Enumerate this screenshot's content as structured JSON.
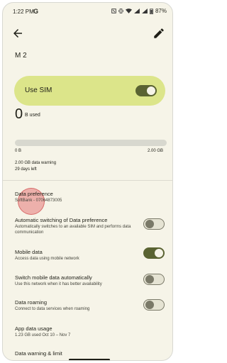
{
  "status": {
    "time": "1:22 PM",
    "g": "G",
    "battery": "87%"
  },
  "app_bar": {
    "back_icon": "back-arrow-icon",
    "edit_icon": "edit-pencil-icon"
  },
  "title": "M 2",
  "use_sim": {
    "label": "Use SIM",
    "on": true
  },
  "usage": {
    "value": "0",
    "unit": "B used",
    "min_label": "0 B",
    "max_label": "2.00 GB",
    "fill_fraction": 0,
    "warning": "2.00 GB data warning",
    "days_left": "29 days left"
  },
  "rows": [
    {
      "title": "Data preference",
      "subtitle": "SoftBank - 07064873005"
    },
    {
      "title": "Automatic switching of Data preference",
      "subtitle": "Automatically switches to an available SIM and performs data communication",
      "toggle": false
    },
    {
      "title": "Mobile data",
      "subtitle": "Access data using mobile network",
      "toggle": true
    },
    {
      "title": "Switch mobile data automatically",
      "subtitle": "Use this network when it has better availability",
      "toggle": false
    },
    {
      "title": "Data roaming",
      "subtitle": "Connect to data services when roaming",
      "toggle": false
    },
    {
      "title": "App data usage",
      "subtitle": "1.23 GB used Oct 10 – Nov 7"
    },
    {
      "title": "Data warning & limit",
      "subtitle": ""
    }
  ],
  "colors": {
    "accent": "#5a6332",
    "card": "#dce58a",
    "background": "#f6f4e8"
  }
}
